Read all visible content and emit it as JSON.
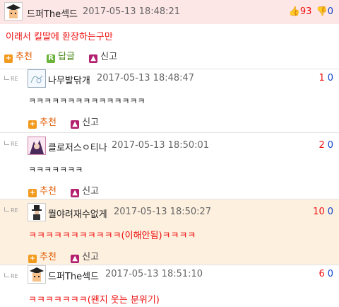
{
  "comments": [
    {
      "nick": "드퍼The섹드",
      "date": "2017-05-13 18:48:21",
      "up": "93",
      "down": "0",
      "body": "이래서 킬딸에 환장하는구만",
      "actions": {
        "recommend": "추천",
        "reply": "답글",
        "report": "신고"
      }
    },
    {
      "re": "RE",
      "nick": "나무발닦개",
      "date": "2017-05-13 18:48:47",
      "up": "1",
      "down": "0",
      "body": "ㅋㅋㅋㅋㅋㅋㅋㅋㅋㅋㅋㅋㅋㅋㅋ",
      "actions": {
        "recommend": "추천",
        "report": "신고"
      }
    },
    {
      "re": "RE",
      "nick": "클로저스ㅇ티나",
      "date": "2017-05-13 18:50:01",
      "up": "2",
      "down": "0",
      "body": "ㅋㅋㅋㅋㅋㅋㅋ",
      "actions": {
        "recommend": "추천",
        "report": "신고"
      }
    },
    {
      "re": "RE",
      "nick": "뭘야려재수없게",
      "date": "2017-05-13 18:50:27",
      "up": "10",
      "down": "0",
      "body": "ㅋㅋㅋㅋㅋㅋㅋㅋㅋㅋㅋ(이해안됨)ㅋㅋㅋㅋ",
      "actions": {
        "recommend": "추천",
        "report": "신고"
      }
    },
    {
      "re": "RE",
      "nick": "드퍼The섹드",
      "date": "2017-05-13 18:51:10",
      "up": "6",
      "down": "0",
      "body": "ㅋㅋㅋㅋㅋㅋㅋ(왠지 웃는 분위기)"
    }
  ],
  "colors": {
    "highlight_top": "#fde6e6",
    "highlight_hot": "#fdf0df",
    "up": "#ee1111",
    "down": "#1144cc"
  }
}
